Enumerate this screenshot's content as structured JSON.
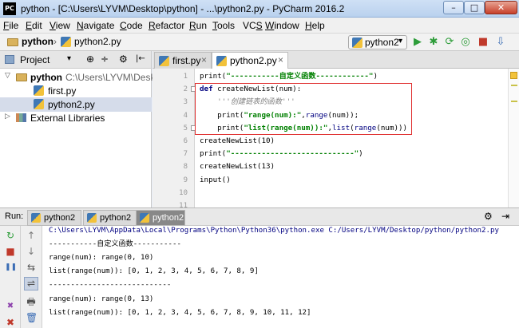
{
  "window": {
    "app_icon_text": "PC",
    "title": "python - [C:\\Users\\LYVM\\Desktop\\python] - ...\\python2.py - PyCharm 2016.2",
    "min_glyph": "–",
    "max_glyph": "□",
    "close_glyph": "✕"
  },
  "menu": {
    "items": [
      {
        "u": "F",
        "rest": "ile"
      },
      {
        "u": "E",
        "rest": "dit"
      },
      {
        "u": "V",
        "rest": "iew"
      },
      {
        "u": "N",
        "rest": "avigate"
      },
      {
        "u": "C",
        "rest": "ode"
      },
      {
        "u": "R",
        "rest": "efactor"
      },
      {
        "u": "R",
        "rest": "un"
      },
      {
        "u": "T",
        "rest": "ools"
      },
      {
        "u": "",
        "rest": "VC",
        "tail": "S"
      },
      {
        "u": "W",
        "rest": "indow"
      },
      {
        "u": "H",
        "rest": "elp"
      }
    ]
  },
  "nav": {
    "project": "python",
    "separator": "›",
    "file": "python2.py",
    "run_config": "python2",
    "dropdown_glyph": "▾"
  },
  "toolbar_icons": [
    "▶",
    "✱",
    "⟳",
    "◎",
    "■",
    "⇩"
  ],
  "project_panel": {
    "title": "Project",
    "dropdown_glyph": "▾",
    "header_icons": [
      "⊕",
      "÷",
      "⚙",
      "|←"
    ],
    "tree": [
      {
        "indent": 0,
        "arrow": "▽",
        "kind": "folder",
        "name": "python",
        "path": "C:\\Users\\LYVM\\Deskto"
      },
      {
        "indent": 1,
        "arrow": "",
        "kind": "py",
        "name": "first.py",
        "path": ""
      },
      {
        "indent": 1,
        "arrow": "",
        "kind": "py",
        "name": "python2.py",
        "path": "",
        "selected": true
      },
      {
        "indent": 0,
        "arrow": "▷",
        "kind": "lib",
        "name": "External Libraries",
        "path": ""
      }
    ]
  },
  "editor_tabs": [
    {
      "name": "first.py",
      "close": "×"
    },
    {
      "name": "python2.py",
      "close": "×",
      "active": true
    }
  ],
  "editor": {
    "line_numbers": [
      "1",
      "2",
      "3",
      "4",
      "5",
      "6",
      "7",
      "8",
      "9",
      "10",
      "11"
    ],
    "lines": [
      [
        {
          "t": "print(",
          "c": "fn"
        },
        {
          "t": "\"-----------自定义函数------------\"",
          "c": "str"
        },
        {
          "t": ")",
          "c": "fn"
        }
      ],
      [
        {
          "t": "def ",
          "c": "kw"
        },
        {
          "t": "createNewList(num):",
          "c": "fn"
        }
      ],
      [
        {
          "t": "    '''创建链表的函数'''",
          "c": "cmt"
        }
      ],
      [
        {
          "t": "    print(",
          "c": "fn"
        },
        {
          "t": "\"range(num):\"",
          "c": "str"
        },
        {
          "t": ",",
          "c": "fn"
        },
        {
          "t": "range",
          "c": "bi"
        },
        {
          "t": "(num));",
          "c": "fn"
        }
      ],
      [
        {
          "t": "    print(",
          "c": "fn"
        },
        {
          "t": "\"list(range(num)):\"",
          "c": "str"
        },
        {
          "t": ",",
          "c": "fn"
        },
        {
          "t": "list",
          "c": "bi"
        },
        {
          "t": "(",
          "c": "fn"
        },
        {
          "t": "range",
          "c": "bi"
        },
        {
          "t": "(num)))",
          "c": "fn"
        }
      ],
      [
        {
          "t": "createNewList(10)",
          "c": "fn"
        }
      ],
      [
        {
          "t": "print(",
          "c": "fn"
        },
        {
          "t": "\"----------------------------\"",
          "c": "str"
        },
        {
          "t": ")",
          "c": "fn"
        }
      ],
      [
        {
          "t": "createNewList(13)",
          "c": "fn"
        }
      ],
      [
        {
          "t": "input()",
          "c": "fn"
        }
      ],
      [
        {
          "t": "",
          "c": "fn"
        }
      ],
      [
        {
          "t": "",
          "c": "fn"
        }
      ]
    ]
  },
  "run_panel": {
    "label": "Run:",
    "tabs": [
      {
        "name": "python2"
      },
      {
        "name": "python2"
      },
      {
        "name": "python2",
        "active": true
      }
    ],
    "right_icons": [
      "⚙",
      "⇥"
    ],
    "left_icons": [
      "↻",
      "■",
      "❚❚",
      "✖",
      "✖"
    ],
    "left_icons2": [
      "↑",
      "↓",
      "⇆",
      "⇌",
      "🖶",
      "🗑"
    ],
    "console": [
      {
        "text": "C:\\Users\\LYVM\\AppData\\Local\\Programs\\Python\\Python36\\python.exe C:/Users/LYVM/Desktop/python/python2.py",
        "cmd": true
      },
      {
        "text": "-----------自定义函数-----------"
      },
      {
        "text": "range(num): range(0, 10)"
      },
      {
        "text": "list(range(num)): [0, 1, 2, 3, 4, 5, 6, 7, 8, 9]"
      },
      {
        "text": "----------------------------"
      },
      {
        "text": "range(num): range(0, 13)"
      },
      {
        "text": "list(range(num)): [0, 1, 2, 3, 4, 5, 6, 7, 8, 9, 10, 11, 12]"
      }
    ]
  },
  "colors": {
    "selection_box": "#e03030",
    "current_line": "#ffffd8",
    "string": "#008000",
    "keyword": "#000080"
  }
}
